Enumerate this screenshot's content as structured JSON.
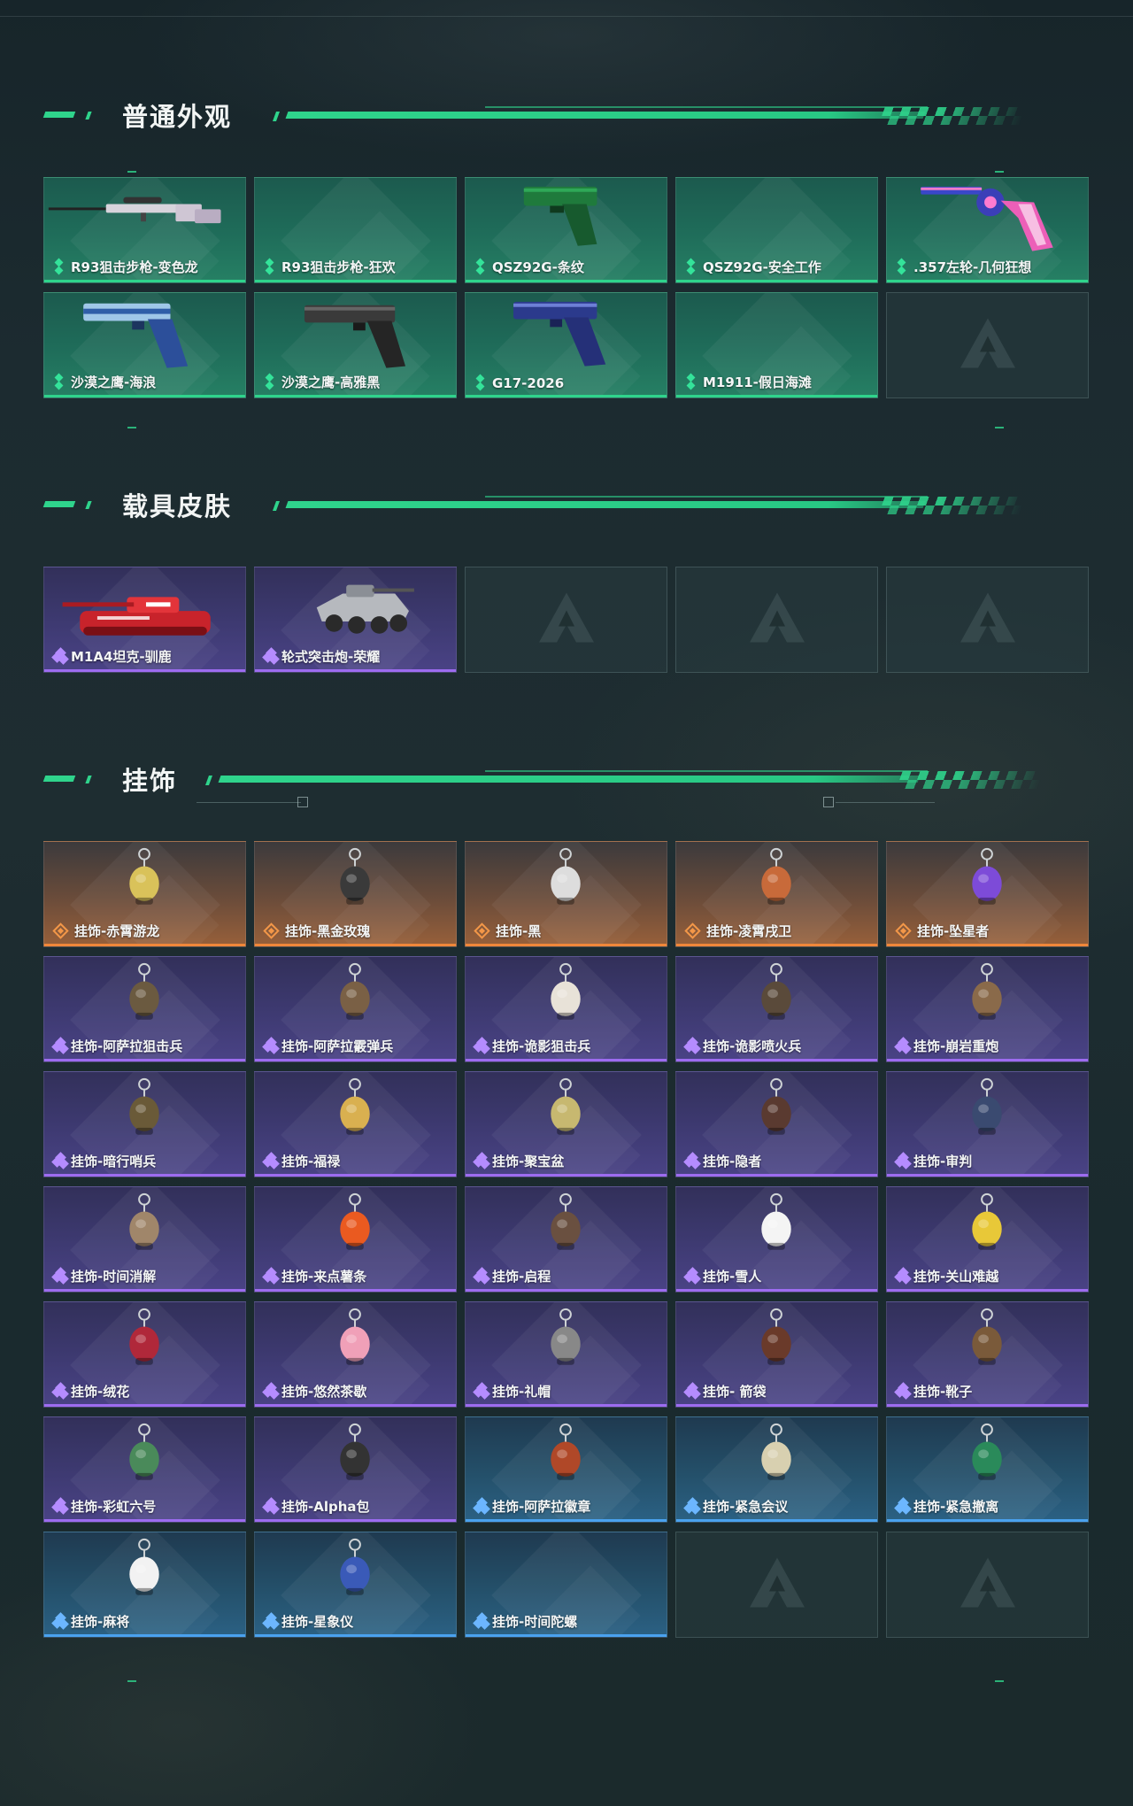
{
  "sections": [
    {
      "title": "普通外观",
      "items": [
        {
          "label": "R93狙击步枪-变色龙",
          "rarity": "green",
          "art": "sniper-rifle"
        },
        {
          "label": "R93狙击步枪-狂欢",
          "rarity": "green",
          "art": "none"
        },
        {
          "label": "QSZ92G-条纹",
          "rarity": "green",
          "art": "pistol-green"
        },
        {
          "label": "QSZ92G-安全工作",
          "rarity": "green",
          "art": "none"
        },
        {
          "label": ".357左轮-几何狂想",
          "rarity": "green",
          "art": "revolver"
        },
        {
          "label": "沙漠之鹰-海浪",
          "rarity": "green",
          "art": "deagle-blue"
        },
        {
          "label": "沙漠之鹰-高雅黑",
          "rarity": "green",
          "art": "deagle-black"
        },
        {
          "label": "G17-2026",
          "rarity": "green",
          "art": "glock-blue"
        },
        {
          "label": "M1911-假日海滩",
          "rarity": "green",
          "art": "none"
        },
        {
          "label": "",
          "rarity": "empty",
          "art": "logo"
        }
      ]
    },
    {
      "title": "载具皮肤",
      "items": [
        {
          "label": "M1A4坦克-驯鹿",
          "rarity": "purple",
          "art": "tank"
        },
        {
          "label": "轮式突击炮-荣耀",
          "rarity": "purple",
          "art": "wheeled"
        },
        {
          "label": "",
          "rarity": "empty",
          "art": "logo"
        },
        {
          "label": "",
          "rarity": "empty",
          "art": "logo"
        },
        {
          "label": "",
          "rarity": "empty",
          "art": "logo"
        }
      ]
    },
    {
      "title": "挂饰",
      "items": [
        {
          "label": "挂饰-赤霄游龙",
          "rarity": "orange",
          "art": "charm"
        },
        {
          "label": "挂饰-黑金玫瑰",
          "rarity": "orange",
          "art": "charm"
        },
        {
          "label": "挂饰-黑",
          "rarity": "orange",
          "art": "charm"
        },
        {
          "label": "挂饰-凌霄戌卫",
          "rarity": "orange",
          "art": "charm"
        },
        {
          "label": "挂饰-坠星者",
          "rarity": "orange",
          "art": "charm"
        },
        {
          "label": "挂饰-阿萨拉狙击兵",
          "rarity": "purple",
          "art": "charm"
        },
        {
          "label": "挂饰-阿萨拉霰弹兵",
          "rarity": "purple",
          "art": "charm"
        },
        {
          "label": "挂饰-诡影狙击兵",
          "rarity": "purple",
          "art": "charm"
        },
        {
          "label": "挂饰-诡影喷火兵",
          "rarity": "purple",
          "art": "charm"
        },
        {
          "label": "挂饰-崩岩重炮",
          "rarity": "purple",
          "art": "charm"
        },
        {
          "label": "挂饰-暗行哨兵",
          "rarity": "purple",
          "art": "charm"
        },
        {
          "label": "挂饰-福禄",
          "rarity": "purple",
          "art": "charm"
        },
        {
          "label": "挂饰-聚宝盆",
          "rarity": "purple",
          "art": "charm"
        },
        {
          "label": "挂饰-隐者",
          "rarity": "purple",
          "art": "charm"
        },
        {
          "label": "挂饰-审判",
          "rarity": "purple",
          "art": "charm"
        },
        {
          "label": "挂饰-时间消解",
          "rarity": "purple",
          "art": "charm"
        },
        {
          "label": "挂饰-来点薯条",
          "rarity": "purple",
          "art": "charm"
        },
        {
          "label": "挂饰-启程",
          "rarity": "purple",
          "art": "charm"
        },
        {
          "label": "挂饰-雪人",
          "rarity": "purple",
          "art": "charm"
        },
        {
          "label": "挂饰-关山难越",
          "rarity": "purple",
          "art": "charm"
        },
        {
          "label": "挂饰-绒花",
          "rarity": "purple",
          "art": "charm"
        },
        {
          "label": "挂饰-悠然茶歇",
          "rarity": "purple",
          "art": "charm"
        },
        {
          "label": "挂饰-礼帽",
          "rarity": "purple",
          "art": "charm"
        },
        {
          "label": "挂饰- 箭袋",
          "rarity": "purple",
          "art": "charm"
        },
        {
          "label": "挂饰-靴子",
          "rarity": "purple",
          "art": "charm"
        },
        {
          "label": "挂饰-彩虹六号",
          "rarity": "purple",
          "art": "charm"
        },
        {
          "label": "挂饰-Alpha包",
          "rarity": "purple",
          "art": "charm"
        },
        {
          "label": "挂饰-阿萨拉徽章",
          "rarity": "blue",
          "art": "charm"
        },
        {
          "label": "挂饰-紧急会议",
          "rarity": "blue",
          "art": "charm"
        },
        {
          "label": "挂饰-紧急撤离",
          "rarity": "blue",
          "art": "charm"
        },
        {
          "label": "挂饰-麻将",
          "rarity": "blue",
          "art": "charm"
        },
        {
          "label": "挂饰-星象仪",
          "rarity": "blue",
          "art": "charm"
        },
        {
          "label": "挂饰-时间陀螺",
          "rarity": "blue",
          "art": "none"
        },
        {
          "label": "",
          "rarity": "empty",
          "art": "logo"
        },
        {
          "label": "",
          "rarity": "empty",
          "art": "logo"
        }
      ]
    }
  ],
  "colors": {
    "accent_green": "#2fd48c",
    "rarity_green": "#2fd48c",
    "rarity_purple": "#9d6cf0",
    "rarity_orange": "#f0873a",
    "rarity_blue": "#4aa2ef"
  }
}
